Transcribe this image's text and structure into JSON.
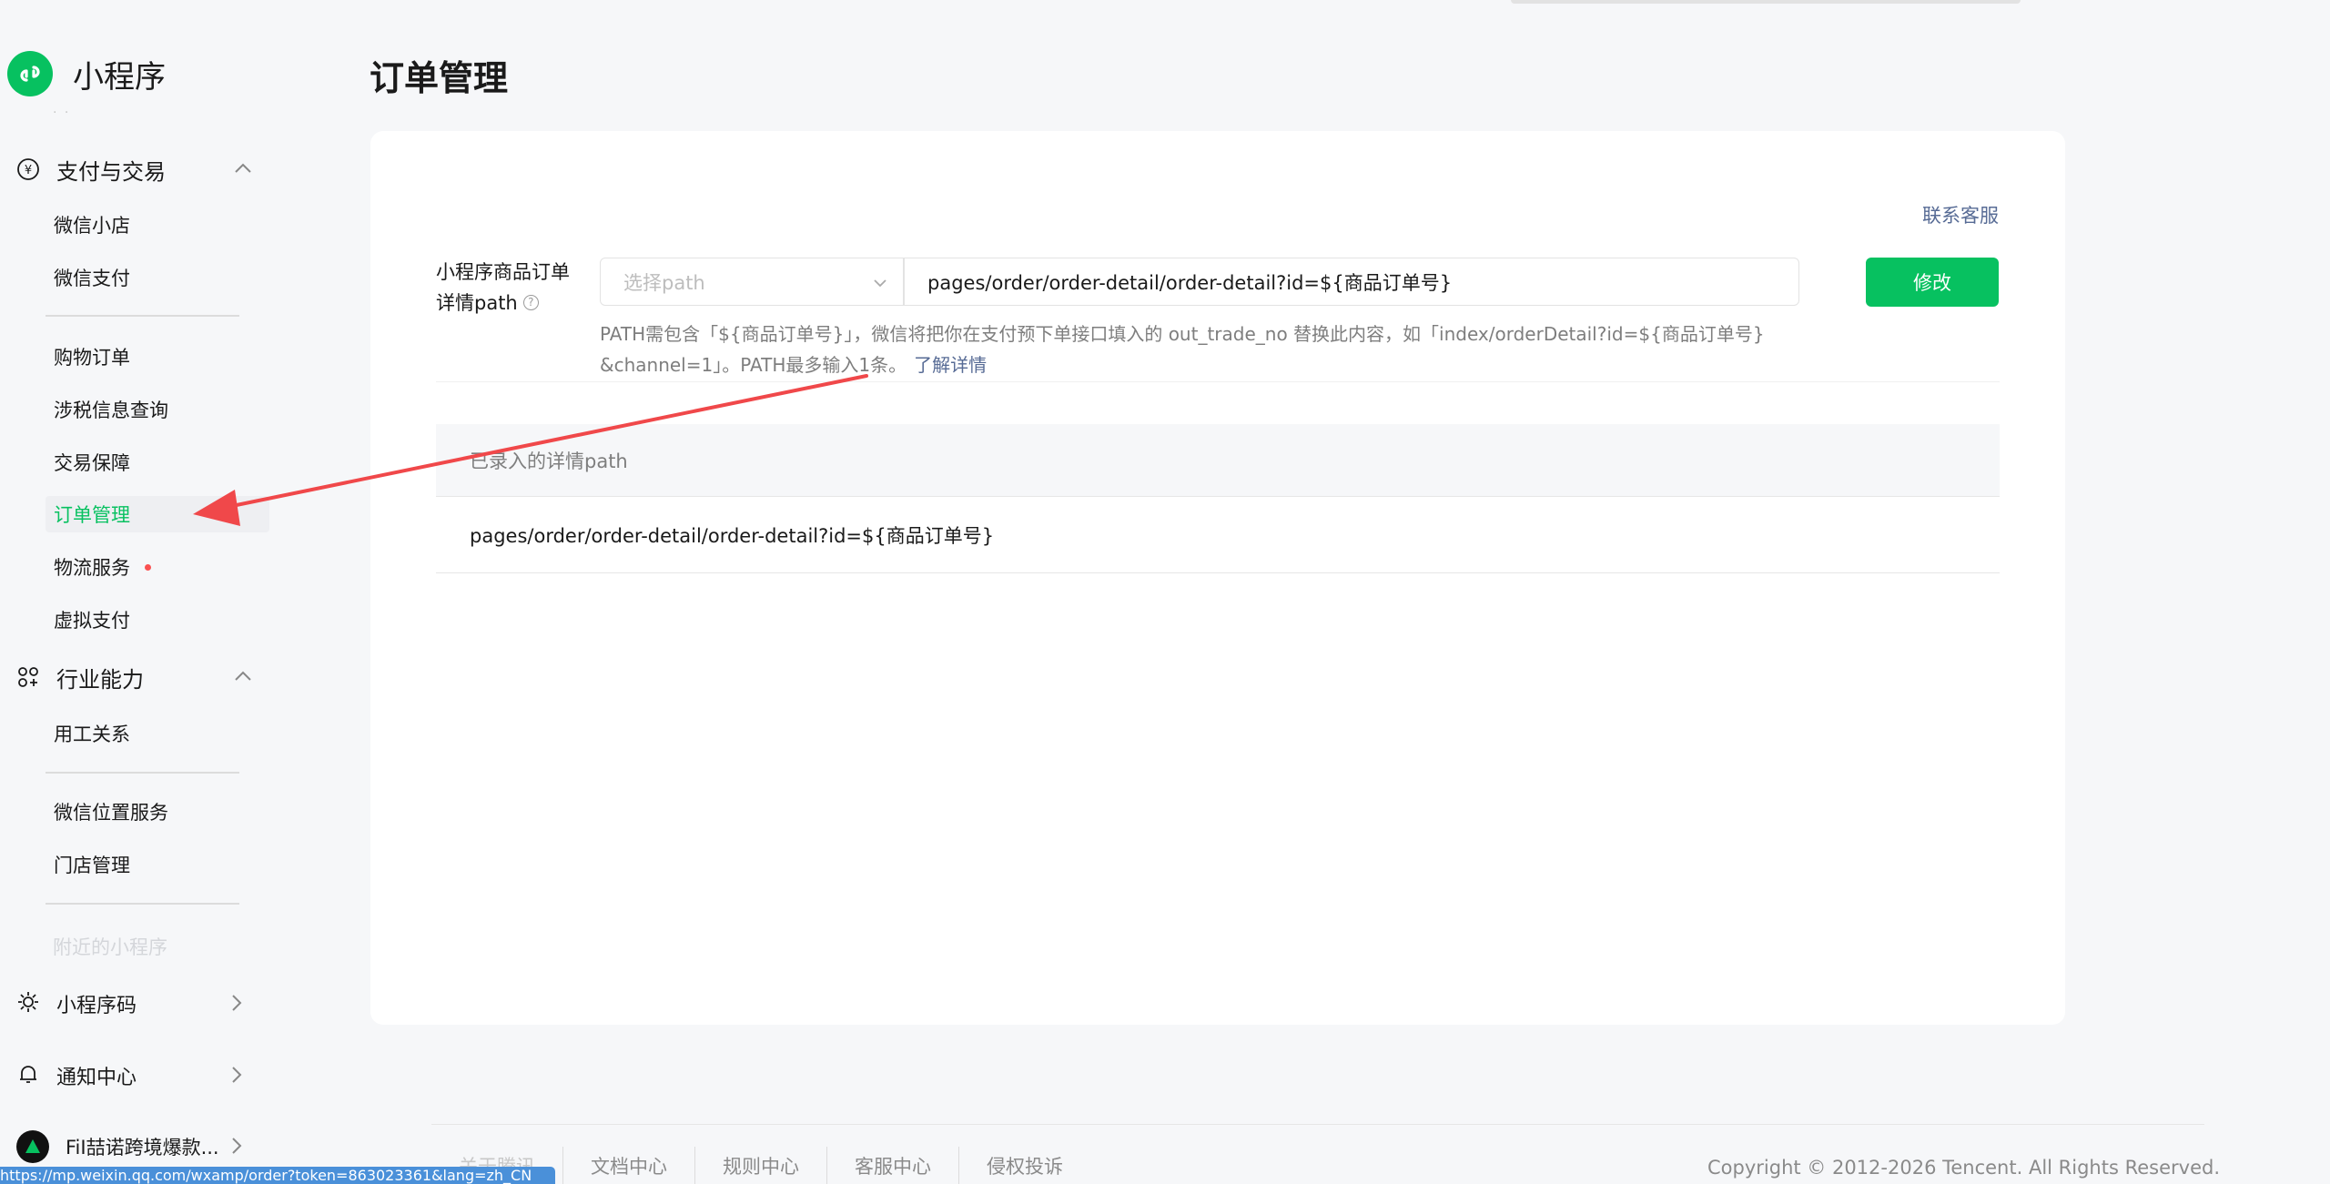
{
  "brand": {
    "title": "小程序"
  },
  "sidebar": {
    "faded_top": "· ·",
    "group_payment": {
      "label": "支付与交易",
      "icon": "yen-circle-icon"
    },
    "payment_items": [
      "微信小店",
      "微信支付"
    ],
    "payment_items_2": [
      "购物订单",
      "涉税信息查询",
      "交易保障",
      "订单管理",
      "物流服务",
      "虚拟支付"
    ],
    "active_item": "订单管理",
    "group_industry": {
      "label": "行业能力",
      "icon": "industry-icon"
    },
    "industry_items": [
      "用工关系"
    ],
    "industry_items_2": [
      "微信位置服务",
      "门店管理"
    ],
    "faded_item": "附近的小程序",
    "bottom": {
      "qrcode": "小程序码",
      "notify": "通知中心",
      "account": "FiI喆诺跨境爆款..."
    }
  },
  "main": {
    "title": "订单管理",
    "contact_link": "联系客服",
    "form": {
      "label_line1": "小程序商品订单",
      "label_line2": "详情path",
      "help": "?",
      "select_placeholder": "选择path",
      "path_value": "pages/order/order-detail/order-detail?id=${商品订单号}",
      "modify_label": "修改",
      "hint_line1": "PATH需包含「${商品订单号}」，微信将把你在支付预下单接口填入的 out_trade_no 替换此内容，如「index/orderDetail?id=${商品订单号}",
      "hint_line2": "&channel=1」。PATH最多输入1条。",
      "learn_more": "了解详情"
    },
    "table": {
      "header": "已录入的详情path",
      "rows": [
        "pages/order/order-detail/order-detail?id=${商品订单号}"
      ]
    }
  },
  "footer": {
    "links": [
      "关于腾讯",
      "文档中心",
      "规则中心",
      "客服中心",
      "侵权投诉"
    ],
    "copyright": "Copyright © 2012-2026 Tencent. All Rights Reserved."
  },
  "status_bar": {
    "url": "https://mp.weixin.qq.com/wxamp/order?token=863023361&lang=zh_CN"
  },
  "colors": {
    "accent": "#07c160",
    "link": "#576b95",
    "annotation_arrow": "#f0484a"
  }
}
